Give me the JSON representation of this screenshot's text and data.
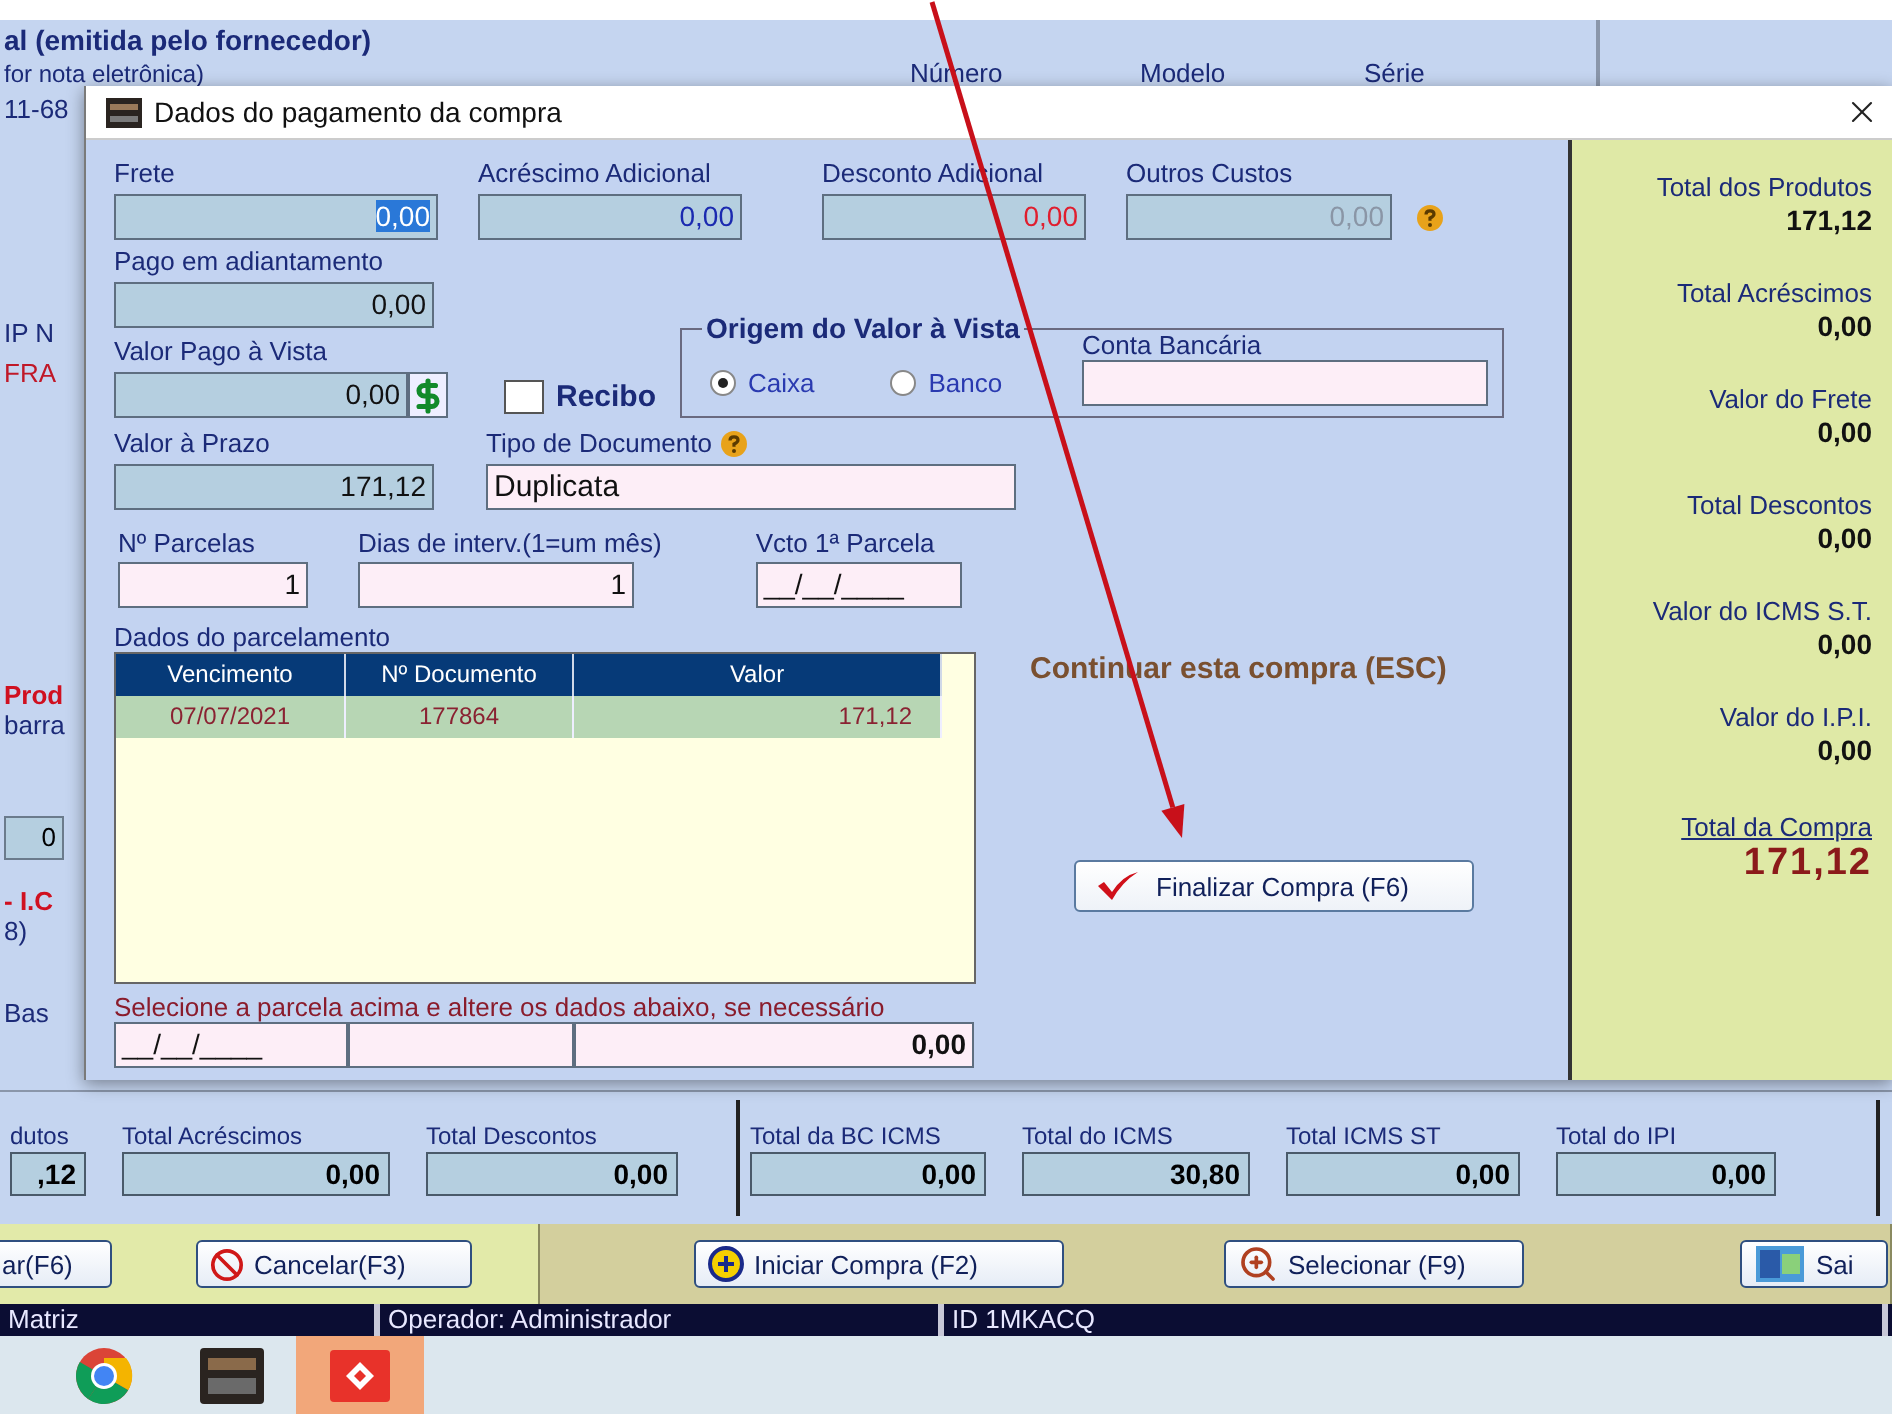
{
  "background_window": {
    "header": {
      "title": "al (emitida pelo fornecedor)",
      "subtitle": "for nota eletrônica)",
      "columns": [
        "Número",
        "Modelo",
        "Série"
      ]
    },
    "left_fragments": [
      {
        "kind": "text",
        "text": "11-68"
      },
      {
        "kind": "text",
        "text": "IP N"
      },
      {
        "kind": "alert",
        "text": "FRA"
      },
      {
        "kind": "strong_alert",
        "text": "Prod"
      },
      {
        "kind": "text",
        "text": "barra"
      },
      {
        "kind": "field",
        "text": "0"
      },
      {
        "kind": "strong_alert",
        "text": "- I.C"
      },
      {
        "kind": "text",
        "text": "8)"
      },
      {
        "kind": "text",
        "text": "Bas"
      }
    ],
    "totals": [
      {
        "label": "dutos",
        "value": ",12"
      },
      {
        "label": "Total Acréscimos",
        "value": "0,00"
      },
      {
        "label": "Total Descontos",
        "value": "0,00"
      },
      {
        "label": "Total da BC ICMS",
        "value": "0,00"
      },
      {
        "label": "Total do ICMS",
        "value": "30,80"
      },
      {
        "label": "Total ICMS ST",
        "value": "0,00"
      },
      {
        "label": "Total do IPI",
        "value": "0,00"
      }
    ],
    "buttons": [
      {
        "kind": "plain",
        "label": "ar(F6)"
      },
      {
        "kind": "cancel",
        "label": "Cancelar(F3)"
      },
      {
        "kind": "start",
        "label": "Iniciar Compra (F2)"
      },
      {
        "kind": "select",
        "label": "Selecionar (F9)"
      },
      {
        "kind": "exit",
        "label": "Sai"
      }
    ],
    "status_bar": [
      "Matriz",
      "Operador: Administrador",
      "ID 1MKACQ"
    ]
  },
  "dialog": {
    "title": "Dados do pagamento da compra",
    "charges": [
      {
        "label": "Frete",
        "value": "0,00",
        "kind": "normal",
        "selected": true,
        "help": false
      },
      {
        "label": "Acréscimo Adicional",
        "value": "0,00",
        "kind": "normal",
        "selected": false,
        "help": false
      },
      {
        "label": "Desconto Adicional",
        "value": "0,00",
        "kind": "discount",
        "selected": false,
        "help": false
      },
      {
        "label": "Outros Custos",
        "value": "0,00",
        "kind": "readonly",
        "selected": false,
        "help": true
      }
    ],
    "advance": {
      "label": "Pago em adiantamento",
      "value": "0,00"
    },
    "cash": {
      "label": "Valor Pago à Vista",
      "value": "0,00"
    },
    "receipt": {
      "label": "Recibo",
      "checked": false
    },
    "cash_origin": {
      "title": "Origem do Valor à Vista",
      "options": [
        {
          "label": "Caixa",
          "selected": true
        },
        {
          "label": "Banco",
          "selected": false
        }
      ]
    },
    "bank_account": {
      "label": "Conta Bancária"
    },
    "term_value": {
      "label": "Valor à Prazo",
      "value": "171,12"
    },
    "document_type": {
      "label": "Tipo de Documento",
      "value": "Duplicata"
    },
    "installments": {
      "label": "Nº Parcelas",
      "value": "1"
    },
    "interval": {
      "label": "Dias de interv.(1=um mês)",
      "value": "1"
    },
    "first_due": {
      "label": "Vcto 1ª Parcela",
      "value": "__/__/____"
    },
    "schedule": {
      "title": "Dados do parcelamento",
      "columns": [
        "Vencimento",
        "Nº Documento",
        "Valor"
      ],
      "rows": [
        {
          "cells": [
            "07/07/2021",
            "177864",
            "171,12"
          ],
          "selected": true
        }
      ],
      "hint": "Selecione a parcela acima e altere os dados abaixo, se necessário",
      "edit_date": "__/__/____",
      "edit_value": "0,00"
    },
    "continue_label": "Continuar esta compra (ESC)",
    "finish_button": "Finalizar Compra (F6)",
    "summary": [
      {
        "label": "Total dos Produtos",
        "value": "171,12",
        "kind": "normal"
      },
      {
        "label": "Total Acréscimos",
        "value": "0,00",
        "kind": "normal"
      },
      {
        "label": "Valor do Frete",
        "value": "0,00",
        "kind": "normal"
      },
      {
        "label": "Total Descontos",
        "value": "0,00",
        "kind": "normal"
      },
      {
        "label": "Valor do ICMS S.T.",
        "value": "0,00",
        "kind": "normal"
      },
      {
        "label": "Valor do I.P.I.",
        "value": "0,00",
        "kind": "normal"
      },
      {
        "label": "Total da Compra",
        "value": "171,12",
        "kind": "grand"
      }
    ]
  },
  "taskbar": {
    "items": [
      {
        "kind": "browser",
        "selected": false
      },
      {
        "kind": "app",
        "selected": false
      },
      {
        "kind": "remote",
        "selected": true
      }
    ]
  },
  "annotation": {
    "kind": "arrow"
  }
}
